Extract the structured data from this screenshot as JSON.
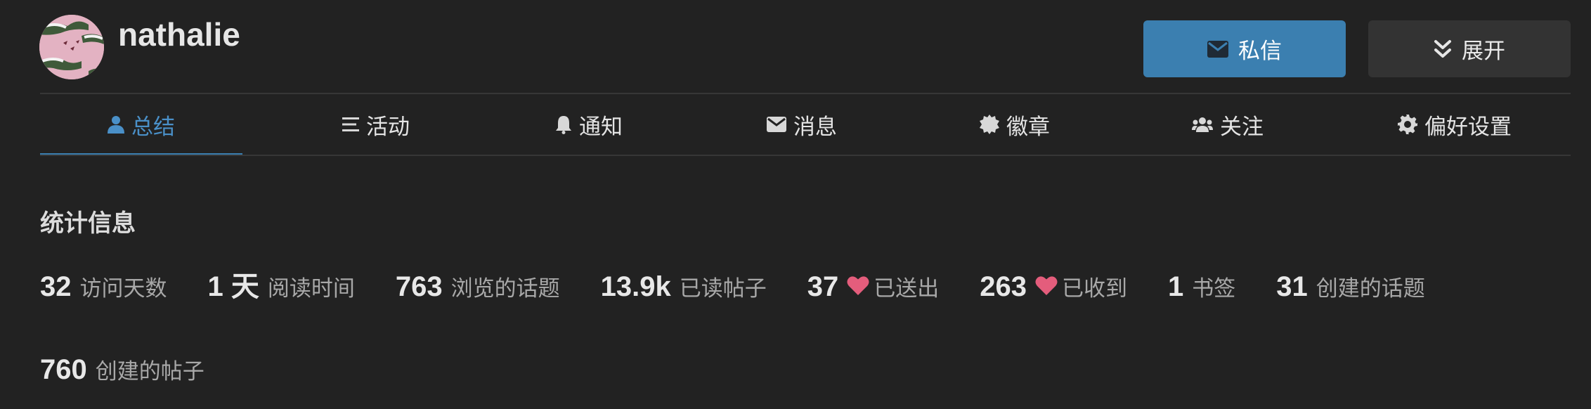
{
  "user": {
    "username": "nathalie"
  },
  "actions": {
    "message_label": "私信",
    "expand_label": "展开"
  },
  "nav": {
    "items": [
      {
        "label": "总结",
        "icon": "user-icon",
        "active": true
      },
      {
        "label": "活动",
        "icon": "list-icon",
        "active": false
      },
      {
        "label": "通知",
        "icon": "bell-icon",
        "active": false
      },
      {
        "label": "消息",
        "icon": "envelope-icon",
        "active": false
      },
      {
        "label": "徽章",
        "icon": "badge-icon",
        "active": false
      },
      {
        "label": "关注",
        "icon": "users-icon",
        "active": false
      },
      {
        "label": "偏好设置",
        "icon": "gear-icon",
        "active": false
      }
    ]
  },
  "stats": {
    "title": "统计信息",
    "items": [
      {
        "value": "32",
        "label": "访问天数"
      },
      {
        "value": "1 天",
        "label": "阅读时间"
      },
      {
        "value": "763",
        "label": "浏览的话题"
      },
      {
        "value": "13.9k",
        "label": "已读帖子"
      },
      {
        "value": "37",
        "label": "已送出",
        "icon": "heart-icon"
      },
      {
        "value": "263",
        "label": "已收到",
        "icon": "heart-icon"
      },
      {
        "value": "1",
        "label": "书签"
      },
      {
        "value": "31",
        "label": "创建的话题"
      },
      {
        "value": "760",
        "label": "创建的帖子"
      }
    ]
  },
  "colors": {
    "background": "#222222",
    "accent": "#3b7fb0",
    "active_tab": "#4a90c8",
    "heart": "#e45d7c"
  }
}
